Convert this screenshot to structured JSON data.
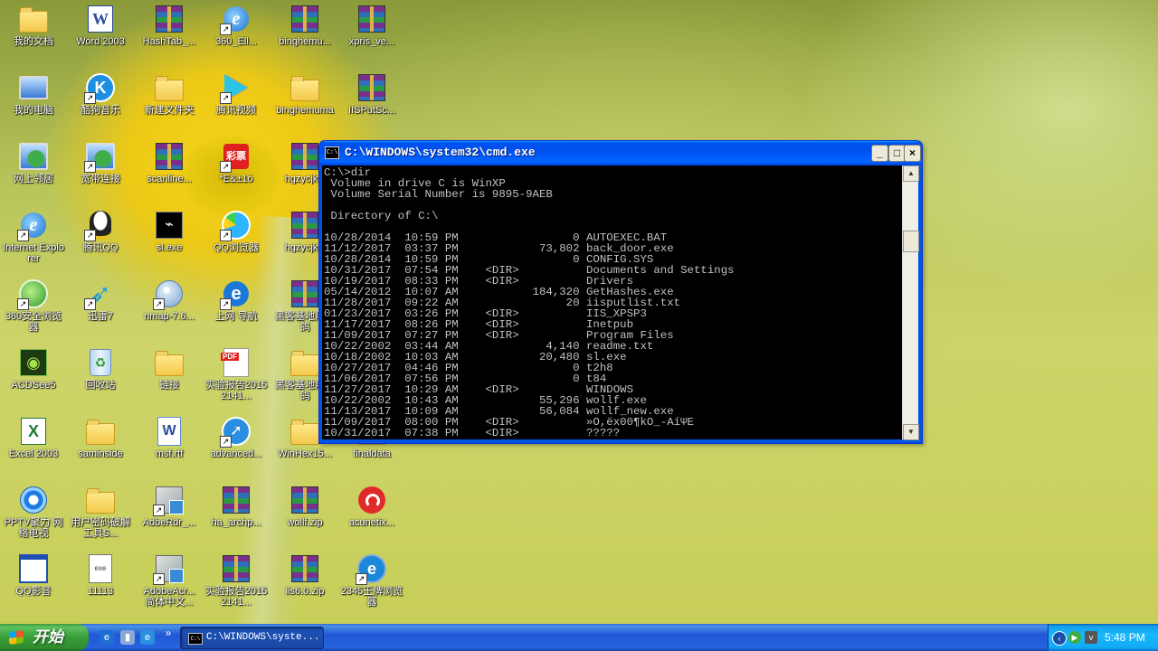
{
  "desktop": {
    "icons": [
      {
        "label": "我的文档",
        "icon": "my-documents-icon"
      },
      {
        "label": "Word 2003",
        "icon": "word-icon"
      },
      {
        "label": "HashTab_...",
        "icon": "winrar-archive-icon"
      },
      {
        "label": "360_Ell...",
        "icon": "ie-icon"
      },
      {
        "label": "binghemu...",
        "icon": "winrar-archive-icon"
      },
      {
        "label": "xpris_ve...",
        "icon": "winrar-archive-icon"
      },
      {
        "label": "我的电脑",
        "icon": "my-computer-icon"
      },
      {
        "label": "酷狗音乐",
        "icon": "kugou-icon"
      },
      {
        "label": "新建文件夹",
        "icon": "folder-icon"
      },
      {
        "label": "腾讯视频",
        "icon": "tencent-video-icon"
      },
      {
        "label": "binghemuma",
        "icon": "folder-icon"
      },
      {
        "label": "IISPutSc...",
        "icon": "winrar-archive-icon"
      },
      {
        "label": "网上邻居",
        "icon": "network-icon"
      },
      {
        "label": "宽带连接",
        "icon": "broadband-icon"
      },
      {
        "label": "scanline...",
        "icon": "winrar-archive-icon"
      },
      {
        "label": "*E&±1ò",
        "icon": "lottery-icon"
      },
      {
        "label": "hgzycjkw",
        "icon": "winrar-archive-icon"
      },
      {
        "label": "Internet Explorer",
        "icon": "ie-icon"
      },
      {
        "label": "腾讯QQ",
        "icon": "qq-icon"
      },
      {
        "label": "sl.exe",
        "icon": "console-app-icon"
      },
      {
        "label": "QQ浏览器",
        "icon": "qq-browser-icon"
      },
      {
        "label": "hgzycjkw",
        "icon": "winrar-archive-icon"
      },
      {
        "label": "360安全浏览器",
        "icon": "360-browser-icon"
      },
      {
        "label": "迅雷7",
        "icon": "thunder-icon"
      },
      {
        "label": "nmap-7.6...",
        "icon": "nmap-installer-icon"
      },
      {
        "label": "上网 导航",
        "icon": "ie-blue-icon"
      },
      {
        "label": "黑客基地用灰鸽",
        "icon": "winrar-archive-icon"
      },
      {
        "label": "ACDSee5",
        "icon": "acdsee-icon"
      },
      {
        "label": "回收站",
        "icon": "recycle-bin-icon"
      },
      {
        "label": "链接",
        "icon": "folder-icon"
      },
      {
        "label": "实验报告20152141...",
        "icon": "pdf-icon"
      },
      {
        "label": "黑客基地用灰鸽",
        "icon": "folder-icon"
      },
      {
        "label": "Excel 2003",
        "icon": "excel-icon"
      },
      {
        "label": "saminside",
        "icon": "folder-icon"
      },
      {
        "label": "msf.rtf",
        "icon": "word-document-icon"
      },
      {
        "label": "advanced...",
        "icon": "rocket-icon"
      },
      {
        "label": "WinHex15...",
        "icon": "folder-icon"
      },
      {
        "label": "finaldata",
        "icon": "folder-icon"
      },
      {
        "label": "PPTV聚力 网络电视",
        "icon": "pptv-icon"
      },
      {
        "label": "用户密码破解工具S...",
        "icon": "folder-icon"
      },
      {
        "label": "AdbeRdr_...",
        "icon": "setup-icon"
      },
      {
        "label": "ha_archp...",
        "icon": "winrar-archive-icon"
      },
      {
        "label": "wollf.zip",
        "icon": "winrar-archive-icon"
      },
      {
        "label": "acunetix...",
        "icon": "acunetix-icon"
      },
      {
        "label": "QQ影音",
        "icon": "qq-player-icon"
      },
      {
        "label": "11113",
        "icon": "batch-file-icon"
      },
      {
        "label": "AdobeAcr... 简体中文...",
        "icon": "setup-icon"
      },
      {
        "label": "实验报告20152141...",
        "icon": "winrar-archive-icon"
      },
      {
        "label": "iis6.0.zip",
        "icon": "winrar-archive-icon"
      },
      {
        "label": "2345王牌浏览器",
        "icon": "2345-browser-icon"
      }
    ]
  },
  "cmd_window": {
    "title": "C:\\WINDOWS\\system32\\cmd.exe",
    "icon_text": "C:\\",
    "minimize": "_",
    "maximize": "□",
    "close": "×",
    "output": "C:\\>dir\n Volume in drive C is WinXP\n Volume Serial Number is 9895-9AEB\n\n Directory of C:\\\n\n10/28/2014  10:59 PM                 0 AUTOEXEC.BAT\n11/12/2017  03:37 PM            73,802 back_door.exe\n10/28/2014  10:59 PM                 0 CONFIG.SYS\n10/31/2017  07:54 PM    <DIR>          Documents and Settings\n10/19/2017  08:33 PM    <DIR>          Drivers\n05/14/2012  10:07 AM           184,320 GetHashes.exe\n11/28/2017  09:22 AM                20 iisputlist.txt\n01/23/2017  03:26 PM    <DIR>          IIS_XPSP3\n11/17/2017  08:26 PM    <DIR>          Inetpub\n11/09/2017  07:27 PM    <DIR>          Program Files\n10/22/2002  03:44 AM             4,140 readme.txt\n10/18/2002  10:03 AM            20,480 sl.exe\n10/27/2017  04:46 PM                 0 t2h8\n11/06/2017  07:56 PM                 0 t84\n11/27/2017  10:29 AM    <DIR>          WINDOWS\n10/22/2002  10:43 AM            55,296 wollf.exe\n11/13/2017  10:09 AM            56,084 wollf_new.exe\n11/09/2017  08:00 PM    <DIR>          »O,ëx00¶kO_-AíΨE\n10/31/2017  07:38 PM    <DIR>          ?????"
  },
  "taskbar": {
    "start_label": "开始",
    "task_button": "C:\\WINDOWS\\syste...",
    "task_icon_text": "C:\\",
    "clock": "5:48 PM",
    "quick_launch_more": "»"
  }
}
